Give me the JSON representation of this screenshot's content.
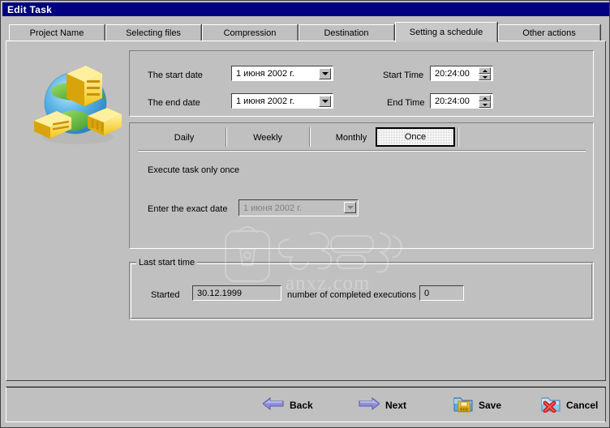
{
  "window": {
    "title": "Edit Task"
  },
  "tabs": [
    {
      "label": "Project Name",
      "selected": false
    },
    {
      "label": "Selecting files",
      "selected": false
    },
    {
      "label": "Compression",
      "selected": false
    },
    {
      "label": "Destination",
      "selected": false
    },
    {
      "label": "Setting a schedule",
      "selected": true
    },
    {
      "label": "Other actions",
      "selected": false
    }
  ],
  "icons": {
    "app_illustration": "globe-with-servers-icon",
    "back_arrow": "arrow-left-icon",
    "next_arrow": "arrow-right-icon",
    "save": "folder-floppy-save-icon",
    "cancel": "folder-red-x-cancel-icon",
    "combo_dropdown": "chevron-down-icon",
    "spinner_up": "spinner-up-icon",
    "spinner_down": "spinner-down-icon"
  },
  "date_panel": {
    "start_date_label": "The start date",
    "start_date_value": "1    июня   2002 г.",
    "end_date_label": "The end date",
    "end_date_value": "1    июня   2002 г.",
    "start_time_label": "Start Time",
    "start_time_value": "20:24:00",
    "end_time_label": "End Time",
    "end_time_value": "20:24:00"
  },
  "schedule_panel": {
    "subtabs": [
      {
        "label": "Daily",
        "selected": false
      },
      {
        "label": "Weekly",
        "selected": false
      },
      {
        "label": "Monthly",
        "selected": false
      },
      {
        "label": "Once",
        "selected": true
      }
    ],
    "description": "Execute task only once",
    "exact_date_label": "Enter the exact date",
    "exact_date_value": "1    июня   2002 г.",
    "exact_date_disabled": true
  },
  "last_start_group": {
    "title": "Last start time",
    "started_label": "Started",
    "started_value": "30.12.1999",
    "executions_label": "number of completed executions",
    "executions_value": "0"
  },
  "buttons": {
    "back": "Back",
    "next": "Next",
    "save": "Save",
    "cancel": "Cancel"
  },
  "watermark": {
    "text": "anxz.com"
  },
  "colors": {
    "titlebar": "#000080",
    "face": "#c0c0c0",
    "field": "#ffffff",
    "shadow": "#808080",
    "dark": "#404040",
    "light": "#ffffff",
    "arrow_blue": "#8080d0",
    "save_yellow": "#ffd040",
    "cancel_red": "#d02020"
  }
}
